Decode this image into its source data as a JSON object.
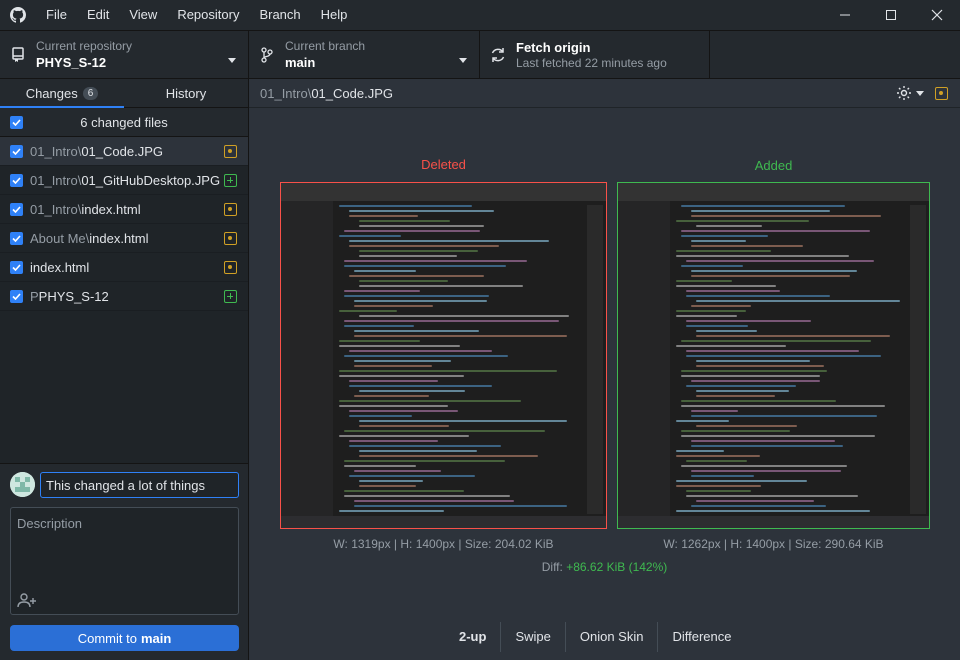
{
  "menu": [
    "File",
    "Edit",
    "View",
    "Repository",
    "Branch",
    "Help"
  ],
  "toolbar": {
    "repo_label": "Current repository",
    "repo_value": "PHYS_S-12",
    "branch_label": "Current branch",
    "branch_value": "main",
    "fetch_label": "Fetch origin",
    "fetch_sub": "Last fetched 22 minutes ago"
  },
  "tabs": {
    "changes": "Changes",
    "changes_count": "6",
    "history": "History"
  },
  "changes_header": "6 changed files",
  "files": [
    {
      "dir": "01_Intro\\",
      "name": "01_Code.JPG",
      "status": "modified",
      "selected": true
    },
    {
      "dir": "01_Intro\\",
      "name": "01_GitHubDesktop.JPG",
      "status": "added",
      "selected": false
    },
    {
      "dir": "01_Intro\\",
      "name": "index.html",
      "status": "modified",
      "selected": false
    },
    {
      "dir": "About Me\\",
      "name": "index.html",
      "status": "modified",
      "selected": false
    },
    {
      "dir": "",
      "name": "index.html",
      "status": "modified",
      "selected": false
    },
    {
      "dir": "P",
      "name": "PHYS_S-12",
      "status": "added",
      "selected": false
    }
  ],
  "commit": {
    "summary_value": "This changed a lot of things",
    "description_placeholder": "Description",
    "button_prefix": "Commit to",
    "button_branch": "main"
  },
  "diff": {
    "path_dir": "01_Intro\\",
    "path_file": "01_Code.JPG",
    "deleted_label": "Deleted",
    "added_label": "Added",
    "deleted_meta": "W: 1319px | H: 1400px | Size: 204.02 KiB",
    "added_meta": "W: 1262px | H: 1400px | Size: 290.64 KiB",
    "diff_label": "Diff:",
    "diff_value": "+86.62 KiB (142%)",
    "modes": [
      "2-up",
      "Swipe",
      "Onion Skin",
      "Difference"
    ],
    "active_mode": "2-up"
  },
  "colors": {
    "accent": "#2f81f7",
    "deleted": "#f85149",
    "added": "#3fb950",
    "modified": "#d0a025"
  }
}
